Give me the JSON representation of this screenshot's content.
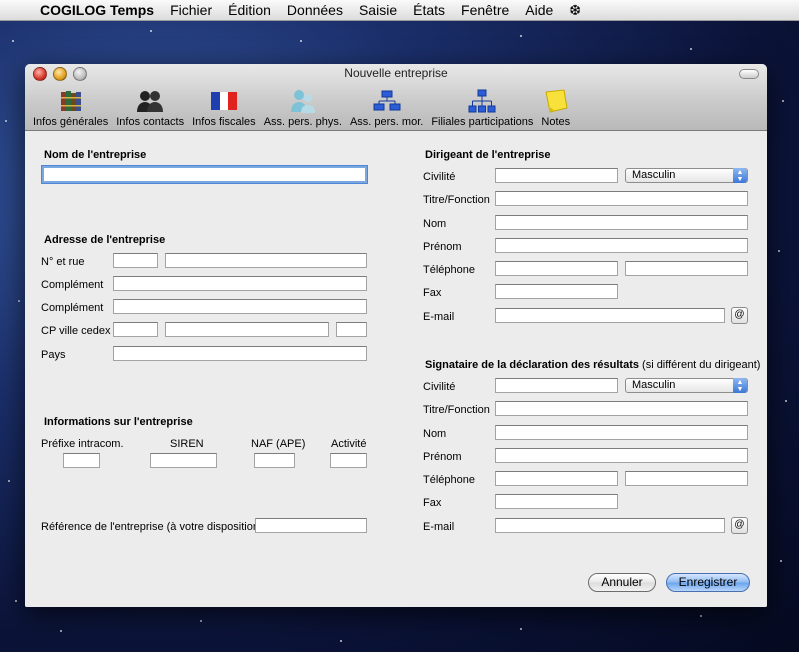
{
  "menubar": {
    "app_name": "COGILOG Temps",
    "items": [
      "Fichier",
      "Édition",
      "Données",
      "Saisie",
      "États",
      "Fenêtre",
      "Aide"
    ]
  },
  "window": {
    "title": "Nouvelle entreprise",
    "toolbar": [
      {
        "label": "Infos générales",
        "icon": "books-icon"
      },
      {
        "label": "Infos contacts",
        "icon": "people-icon"
      },
      {
        "label": "Infos fiscales",
        "icon": "french-flag-icon"
      },
      {
        "label": "Ass. pers. phys.",
        "icon": "persons-icon"
      },
      {
        "label": "Ass. pers. mor.",
        "icon": "org-chart-icon"
      },
      {
        "label": "Filiales participations",
        "icon": "hierarchy-icon"
      },
      {
        "label": "Notes",
        "icon": "sticky-note-icon"
      }
    ]
  },
  "left": {
    "company_name_heading": "Nom de l'entreprise",
    "company_name_value": "",
    "address_heading": "Adresse de l'entreprise",
    "address_labels": {
      "street": "N° et rue",
      "complement1": "Complément",
      "complement2": "Complément",
      "cp_city": "CP ville cedex",
      "country": "Pays"
    },
    "info_heading": "Informations sur l'entreprise",
    "info_labels": {
      "prefix": "Préfixe intracom.",
      "siren": "SIREN",
      "naf": "NAF (APE)",
      "activity": "Activité"
    },
    "reference_label": "Référence de l'entreprise (à votre disposition)"
  },
  "right": {
    "director_heading": "Dirigeant de l'entreprise",
    "signatory_heading": "Signataire de la déclaration des résultats",
    "signatory_note": "(si différent du dirigeant)",
    "labels": {
      "civility": "Civilité",
      "title": "Titre/Fonction",
      "name": "Nom",
      "firstname": "Prénom",
      "phone": "Téléphone",
      "fax": "Fax",
      "email": "E-mail"
    },
    "civility_value": "Masculin",
    "at_symbol": "@"
  },
  "buttons": {
    "cancel": "Annuler",
    "save": "Enregistrer"
  }
}
